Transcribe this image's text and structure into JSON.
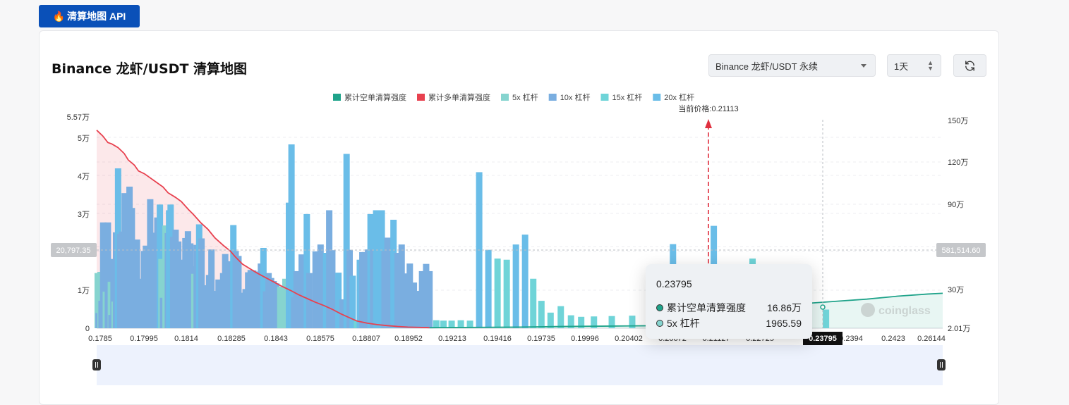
{
  "badge": {
    "icon": "fire-icon",
    "label": "清算地图 API"
  },
  "header": {
    "title": "Binance 龙虾/USDT 清算地图"
  },
  "controls": {
    "pair_select": "Binance 龙虾/USDT 永续",
    "period_select": "1天",
    "refresh_icon": "refresh-icon"
  },
  "legend": [
    {
      "label": "累计空单清算强度",
      "color": "#1fa38a"
    },
    {
      "label": "累计多单清算强度",
      "color": "#e8414f"
    },
    {
      "label": "5x 杠杆",
      "color": "#86d4cf"
    },
    {
      "label": "10x 杠杆",
      "color": "#7aaee0"
    },
    {
      "label": "15x 杠杆",
      "color": "#6fd4d8"
    },
    {
      "label": "20x 杠杆",
      "color": "#6abde8"
    }
  ],
  "watermark": "coinglass",
  "tooltip": {
    "price": "0.23795",
    "rows": [
      {
        "label": "累计空单清算强度",
        "value": "16.86万",
        "color": "#1fa38a"
      },
      {
        "label": "5x 杠杆",
        "value": "1965.59",
        "color": "#86d4cf"
      }
    ]
  },
  "chart_data": {
    "type": "bar",
    "title": "",
    "current_price_label": "当前价格:0.21113",
    "crosshair": {
      "left_value": "20,797.35",
      "right_value": "581,514.60",
      "x_value": "0.23795"
    },
    "left_axis": {
      "ticks": [
        "5.57万",
        "5万",
        "4万",
        "3万",
        "1万",
        "0"
      ],
      "range": [
        0,
        55700
      ]
    },
    "right_axis": {
      "ticks": [
        "150万",
        "120万",
        "90万",
        "30万",
        "2.01万"
      ],
      "range": [
        20100,
        1500000
      ]
    },
    "x_tick_labels": [
      "0.1785",
      "0.17995",
      "0.1814",
      "0.18285",
      "0.1843",
      "0.18575",
      "0.18807",
      "0.18952",
      "0.19213",
      "0.19416",
      "0.19735",
      "0.19996",
      "0.20402",
      "0.20672",
      "0.21127",
      "0.22725",
      "0.23795",
      "0.2394",
      "0.2423",
      "0.26144"
    ],
    "x_range": [
      0.1785,
      0.26144
    ],
    "current_price": 0.21113,
    "bars": [
      {
        "x": 0.1786,
        "value": 14500,
        "kind": "5x"
      },
      {
        "x": 0.17869,
        "value": 4000,
        "kind": "10x"
      },
      {
        "x": 0.17888,
        "value": 14800,
        "kind": "5x"
      },
      {
        "x": 0.17898,
        "value": 7200,
        "kind": "10x"
      },
      {
        "x": 0.17914,
        "value": 27800,
        "kind": "10x"
      },
      {
        "x": 0.1794,
        "value": 9600,
        "kind": "5x"
      },
      {
        "x": 0.1796,
        "value": 27800,
        "kind": "10x"
      },
      {
        "x": 0.17968,
        "value": 4000,
        "kind": "10x"
      },
      {
        "x": 0.17989,
        "value": 12200,
        "kind": "5x"
      },
      {
        "x": 0.17995,
        "value": 3500,
        "kind": "10x"
      },
      {
        "x": 0.18015,
        "value": 18200,
        "kind": "10x"
      },
      {
        "x": 0.18025,
        "value": 7000,
        "kind": "5x"
      },
      {
        "x": 0.1804,
        "value": 25200,
        "kind": "10x"
      },
      {
        "x": 0.1806,
        "value": 42000,
        "kind": "20x"
      },
      {
        "x": 0.1808,
        "value": 24800,
        "kind": "10x"
      },
      {
        "x": 0.181,
        "value": 25400,
        "kind": "10x"
      },
      {
        "x": 0.18125,
        "value": 35500,
        "kind": "10x"
      },
      {
        "x": 0.1815,
        "value": 13300,
        "kind": "10x"
      },
      {
        "x": 0.18172,
        "value": 37200,
        "kind": "10x"
      },
      {
        "x": 0.18195,
        "value": 31600,
        "kind": "10x"
      },
      {
        "x": 0.1822,
        "value": 6700,
        "kind": "10x"
      },
      {
        "x": 0.18245,
        "value": 23300,
        "kind": "10x"
      },
      {
        "x": 0.1827,
        "value": 12000,
        "kind": "10x"
      },
      {
        "x": 0.1829,
        "value": 13000,
        "kind": "10x"
      },
      {
        "x": 0.18314,
        "value": 20300,
        "kind": "10x"
      },
      {
        "x": 0.18333,
        "value": 21700,
        "kind": "10x"
      },
      {
        "x": 0.18352,
        "value": 16900,
        "kind": "10x"
      },
      {
        "x": 0.18375,
        "value": 33900,
        "kind": "10x"
      },
      {
        "x": 0.184,
        "value": 17000,
        "kind": "10x"
      },
      {
        "x": 0.1842,
        "value": 25100,
        "kind": "10x"
      },
      {
        "x": 0.18445,
        "value": 29100,
        "kind": "10x"
      },
      {
        "x": 0.1847,
        "value": 32500,
        "kind": "20x"
      },
      {
        "x": 0.18485,
        "value": 18200,
        "kind": "5x"
      },
      {
        "x": 0.185,
        "value": 8000,
        "kind": "10x"
      },
      {
        "x": 0.18525,
        "value": 27000,
        "kind": "5x"
      },
      {
        "x": 0.18548,
        "value": 25000,
        "kind": "10x"
      },
      {
        "x": 0.1856,
        "value": 31000,
        "kind": "20x"
      },
      {
        "x": 0.18575,
        "value": 32500,
        "kind": "20x"
      },
      {
        "x": 0.186,
        "value": 24000,
        "kind": "10x"
      },
      {
        "x": 0.18624,
        "value": 25900,
        "kind": "10x"
      },
      {
        "x": 0.1865,
        "value": 22800,
        "kind": "10x"
      },
      {
        "x": 0.18672,
        "value": 7500,
        "kind": "10x"
      },
      {
        "x": 0.187,
        "value": 18000,
        "kind": "10x"
      },
      {
        "x": 0.1872,
        "value": 23700,
        "kind": "10x"
      },
      {
        "x": 0.18745,
        "value": 25500,
        "kind": "10x"
      },
      {
        "x": 0.18768,
        "value": 22300,
        "kind": "10x"
      },
      {
        "x": 0.1879,
        "value": 16300,
        "kind": "10x"
      },
      {
        "x": 0.18807,
        "value": 14300,
        "kind": "5x"
      },
      {
        "x": 0.1883,
        "value": 21900,
        "kind": "10x"
      },
      {
        "x": 0.18855,
        "value": 27300,
        "kind": "20x"
      },
      {
        "x": 0.18878,
        "value": 23600,
        "kind": "10x"
      },
      {
        "x": 0.189,
        "value": 11300,
        "kind": "10x"
      },
      {
        "x": 0.18925,
        "value": 7500,
        "kind": "10x"
      },
      {
        "x": 0.18952,
        "value": 14000,
        "kind": "10x"
      },
      {
        "x": 0.18975,
        "value": 20700,
        "kind": "10x"
      },
      {
        "x": 0.18995,
        "value": 7600,
        "kind": "10x"
      },
      {
        "x": 0.1902,
        "value": 9800,
        "kind": "10x"
      },
      {
        "x": 0.19045,
        "value": 12800,
        "kind": "10x"
      },
      {
        "x": 0.1907,
        "value": 9600,
        "kind": "10x"
      },
      {
        "x": 0.1909,
        "value": 14500,
        "kind": "10x"
      },
      {
        "x": 0.1911,
        "value": 19500,
        "kind": "10x"
      },
      {
        "x": 0.1914,
        "value": 17600,
        "kind": "10x"
      },
      {
        "x": 0.19165,
        "value": 10500,
        "kind": "10x"
      },
      {
        "x": 0.1919,
        "value": 27100,
        "kind": "20x"
      },
      {
        "x": 0.19213,
        "value": 20300,
        "kind": "10x"
      },
      {
        "x": 0.1924,
        "value": 19000,
        "kind": "10x"
      },
      {
        "x": 0.1926,
        "value": 9300,
        "kind": "10x"
      },
      {
        "x": 0.19285,
        "value": 9300,
        "kind": "10x"
      },
      {
        "x": 0.1931,
        "value": 10300,
        "kind": "10x"
      },
      {
        "x": 0.19335,
        "value": 14700,
        "kind": "10x"
      },
      {
        "x": 0.1936,
        "value": 15300,
        "kind": "10x"
      },
      {
        "x": 0.19385,
        "value": 15200,
        "kind": "10x"
      },
      {
        "x": 0.19416,
        "value": 14700,
        "kind": "10x"
      },
      {
        "x": 0.19435,
        "value": 14900,
        "kind": "10x"
      },
      {
        "x": 0.1946,
        "value": 17000,
        "kind": "10x"
      },
      {
        "x": 0.19485,
        "value": 21100,
        "kind": "20x"
      },
      {
        "x": 0.1951,
        "value": 9700,
        "kind": "10x"
      },
      {
        "x": 0.19535,
        "value": 14500,
        "kind": "10x"
      },
      {
        "x": 0.1956,
        "value": 13200,
        "kind": "10x"
      },
      {
        "x": 0.19585,
        "value": 12400,
        "kind": "10x"
      },
      {
        "x": 0.1961,
        "value": 11800,
        "kind": "10x"
      },
      {
        "x": 0.1965,
        "value": 10900,
        "kind": "5x"
      },
      {
        "x": 0.1968,
        "value": 10800,
        "kind": "5x"
      },
      {
        "x": 0.197,
        "value": 13000,
        "kind": "5x"
      },
      {
        "x": 0.19735,
        "value": 33000,
        "kind": "20x"
      },
      {
        "x": 0.1976,
        "value": 48300,
        "kind": "20x"
      },
      {
        "x": 0.19785,
        "value": 8200,
        "kind": "10x"
      },
      {
        "x": 0.1981,
        "value": 15000,
        "kind": "10x"
      },
      {
        "x": 0.19835,
        "value": 14500,
        "kind": "10x"
      },
      {
        "x": 0.1986,
        "value": 19400,
        "kind": "10x"
      },
      {
        "x": 0.19885,
        "value": 12000,
        "kind": "10x"
      },
      {
        "x": 0.1991,
        "value": 30000,
        "kind": "20x"
      },
      {
        "x": 0.19935,
        "value": 14500,
        "kind": "10x"
      },
      {
        "x": 0.19996,
        "value": 20200,
        "kind": "10x"
      },
      {
        "x": 0.2002,
        "value": 15500,
        "kind": "10x"
      },
      {
        "x": 0.20045,
        "value": 22000,
        "kind": "10x"
      },
      {
        "x": 0.2007,
        "value": 12700,
        "kind": "10x"
      },
      {
        "x": 0.201,
        "value": 19800,
        "kind": "20x"
      },
      {
        "x": 0.2013,
        "value": 31000,
        "kind": "10x"
      },
      {
        "x": 0.2016,
        "value": 20500,
        "kind": "10x"
      },
      {
        "x": 0.2019,
        "value": 13400,
        "kind": "10x"
      },
      {
        "x": 0.2022,
        "value": 14600,
        "kind": "20x"
      },
      {
        "x": 0.2026,
        "value": 7600,
        "kind": "10x"
      },
      {
        "x": 0.203,
        "value": 45800,
        "kind": "20x"
      },
      {
        "x": 0.2033,
        "value": 20600,
        "kind": "10x"
      },
      {
        "x": 0.2036,
        "value": 13800,
        "kind": "20x"
      },
      {
        "x": 0.20402,
        "value": 2100,
        "kind": "15x"
      },
      {
        "x": 0.2043,
        "value": 18000,
        "kind": "20x"
      },
      {
        "x": 0.20455,
        "value": 20000,
        "kind": "10x"
      },
      {
        "x": 0.2048,
        "value": 15600,
        "kind": "10x"
      },
      {
        "x": 0.2051,
        "value": 20700,
        "kind": "10x"
      },
      {
        "x": 0.20535,
        "value": 30000,
        "kind": "20x"
      },
      {
        "x": 0.2056,
        "value": 20700,
        "kind": "10x"
      },
      {
        "x": 0.2059,
        "value": 31000,
        "kind": "20x"
      },
      {
        "x": 0.2062,
        "value": 26700,
        "kind": "20x"
      },
      {
        "x": 0.20645,
        "value": 31000,
        "kind": "20x"
      },
      {
        "x": 0.20672,
        "value": 20300,
        "kind": "10x"
      },
      {
        "x": 0.207,
        "value": 23800,
        "kind": "10x"
      },
      {
        "x": 0.2073,
        "value": 15300,
        "kind": "10x"
      },
      {
        "x": 0.2076,
        "value": 28500,
        "kind": "20x"
      },
      {
        "x": 0.208,
        "value": 19800,
        "kind": "10x"
      },
      {
        "x": 0.2084,
        "value": 22000,
        "kind": "10x"
      },
      {
        "x": 0.2088,
        "value": 14400,
        "kind": "10x"
      },
      {
        "x": 0.2092,
        "value": 17000,
        "kind": "10x"
      },
      {
        "x": 0.2096,
        "value": 12000,
        "kind": "10x"
      },
      {
        "x": 0.21,
        "value": 9800,
        "kind": "10x"
      },
      {
        "x": 0.2104,
        "value": 15000,
        "kind": "10x"
      },
      {
        "x": 0.2108,
        "value": 16900,
        "kind": "10x"
      },
      {
        "x": 0.21113,
        "value": 15000,
        "kind": "10x"
      },
      {
        "x": 0.2118,
        "value": 2100,
        "kind": "15x"
      },
      {
        "x": 0.2125,
        "value": 2000,
        "kind": "15x"
      },
      {
        "x": 0.2133,
        "value": 2000,
        "kind": "15x"
      },
      {
        "x": 0.2142,
        "value": 2100,
        "kind": "15x"
      },
      {
        "x": 0.2151,
        "value": 2000,
        "kind": "15x"
      },
      {
        "x": 0.216,
        "value": 41000,
        "kind": "20x"
      },
      {
        "x": 0.2169,
        "value": 20600,
        "kind": "20x"
      },
      {
        "x": 0.2178,
        "value": 18300,
        "kind": "15x"
      },
      {
        "x": 0.2187,
        "value": 18000,
        "kind": "15x"
      },
      {
        "x": 0.2196,
        "value": 22000,
        "kind": "20x"
      },
      {
        "x": 0.2205,
        "value": 24600,
        "kind": "20x"
      },
      {
        "x": 0.2213,
        "value": 13000,
        "kind": "15x"
      },
      {
        "x": 0.2221,
        "value": 7200,
        "kind": "15x"
      },
      {
        "x": 0.223,
        "value": 4100,
        "kind": "15x"
      },
      {
        "x": 0.224,
        "value": 5800,
        "kind": "15x"
      },
      {
        "x": 0.225,
        "value": 3400,
        "kind": "15x"
      },
      {
        "x": 0.226,
        "value": 3000,
        "kind": "15x"
      },
      {
        "x": 0.22725,
        "value": 3100,
        "kind": "15x"
      },
      {
        "x": 0.229,
        "value": 3200,
        "kind": "15x"
      },
      {
        "x": 0.231,
        "value": 3300,
        "kind": "15x"
      },
      {
        "x": 0.233,
        "value": 4500,
        "kind": "15x"
      },
      {
        "x": 0.235,
        "value": 22100,
        "kind": "20x"
      },
      {
        "x": 0.23795,
        "value": 2000,
        "kind": "5x"
      },
      {
        "x": 0.2385,
        "value": 2600,
        "kind": "15x"
      },
      {
        "x": 0.239,
        "value": 26900,
        "kind": "20x"
      },
      {
        "x": 0.2394,
        "value": 16500,
        "kind": "15x"
      },
      {
        "x": 0.24,
        "value": 2600,
        "kind": "15x"
      },
      {
        "x": 0.2407,
        "value": 9800,
        "kind": "20x"
      },
      {
        "x": 0.2413,
        "value": 1700,
        "kind": "15x"
      },
      {
        "x": 0.2418,
        "value": 2200,
        "kind": "15x"
      },
      {
        "x": 0.2423,
        "value": 2600,
        "kind": "15x"
      },
      {
        "x": 0.2428,
        "value": 18300,
        "kind": "15x"
      },
      {
        "x": 0.2434,
        "value": 2300,
        "kind": "15x"
      },
      {
        "x": 0.244,
        "value": 2300,
        "kind": "15x"
      },
      {
        "x": 0.245,
        "value": 12300,
        "kind": "20x"
      },
      {
        "x": 0.247,
        "value": 4300,
        "kind": "15x"
      },
      {
        "x": 0.25,
        "value": 4900,
        "kind": "15x"
      }
    ],
    "long_curve": [
      [
        0.1785,
        1380000
      ],
      [
        0.1791,
        1340000
      ],
      [
        0.1796,
        1295000
      ],
      [
        0.18,
        1285000
      ],
      [
        0.1806,
        1260000
      ],
      [
        0.1812,
        1220000
      ],
      [
        0.1816,
        1175000
      ],
      [
        0.1822,
        1140000
      ],
      [
        0.1826,
        1100000
      ],
      [
        0.1832,
        1080000
      ],
      [
        0.1838,
        1050000
      ],
      [
        0.1844,
        1020000
      ],
      [
        0.185,
        990000
      ],
      [
        0.1855,
        950000
      ],
      [
        0.1862,
        920000
      ],
      [
        0.1868,
        890000
      ],
      [
        0.1875,
        835000
      ],
      [
        0.188,
        800000
      ],
      [
        0.1887,
        745000
      ],
      [
        0.1894,
        700000
      ],
      [
        0.1901,
        640000
      ],
      [
        0.1909,
        590000
      ],
      [
        0.1916,
        550000
      ],
      [
        0.1921,
        510000
      ],
      [
        0.1928,
        460000
      ],
      [
        0.1935,
        430000
      ],
      [
        0.1942,
        400000
      ],
      [
        0.195,
        370000
      ],
      [
        0.1958,
        340000
      ],
      [
        0.1966,
        310000
      ],
      [
        0.1975,
        280000
      ],
      [
        0.1983,
        250000
      ],
      [
        0.1991,
        225000
      ],
      [
        0.1999,
        200000
      ],
      [
        0.2008,
        175000
      ],
      [
        0.2016,
        150000
      ],
      [
        0.2024,
        120000
      ],
      [
        0.2032,
        95000
      ],
      [
        0.204,
        70000
      ],
      [
        0.205,
        55000
      ],
      [
        0.206,
        45000
      ],
      [
        0.207,
        38000
      ],
      [
        0.208,
        32000
      ],
      [
        0.209,
        28000
      ],
      [
        0.21,
        26000
      ],
      [
        0.21113,
        24000
      ]
    ],
    "short_curve": [
      [
        0.21113,
        24000
      ],
      [
        0.216,
        26000
      ],
      [
        0.22,
        28000
      ],
      [
        0.224,
        32000
      ],
      [
        0.229,
        35000
      ],
      [
        0.234,
        38000
      ],
      [
        0.23795,
        40000
      ],
      [
        0.2395,
        60000
      ],
      [
        0.241,
        110000
      ],
      [
        0.243,
        160000
      ],
      [
        0.245,
        175000
      ],
      [
        0.248,
        190000
      ],
      [
        0.251,
        205000
      ],
      [
        0.254,
        220000
      ],
      [
        0.257,
        240000
      ],
      [
        0.26,
        255000
      ],
      [
        0.26144,
        260000
      ]
    ]
  }
}
